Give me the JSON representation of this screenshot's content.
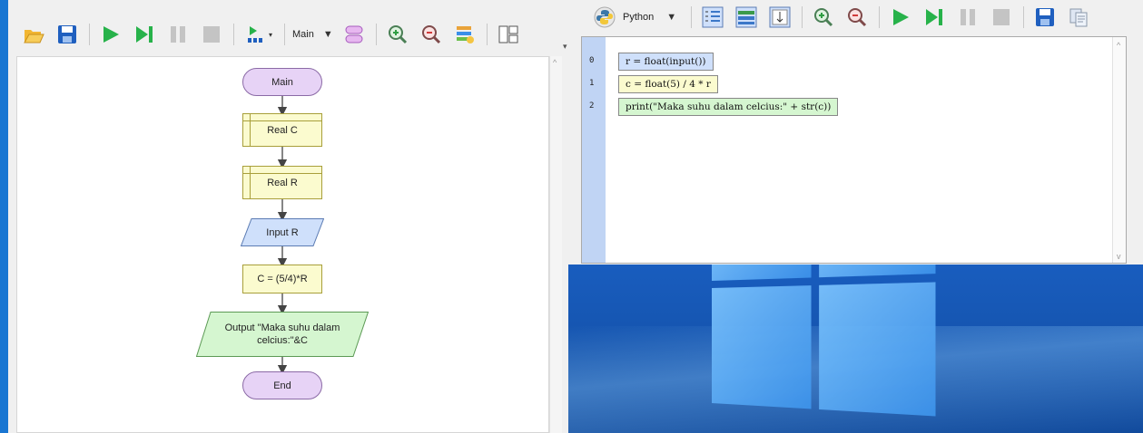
{
  "flowchart_window": {
    "toolbar": {
      "function_dropdown": "Main"
    },
    "shapes": {
      "start": "Main",
      "declare_c": "Real C",
      "declare_r": "Real R",
      "input": "Input R",
      "assign": "C = (5/4)*R",
      "output_line1": "Output \"Maka suhu dalam",
      "output_line2": "celcius:\"&C",
      "end": "End"
    }
  },
  "code_window": {
    "toolbar": {
      "language": "Python"
    },
    "lines": [
      {
        "number": "0",
        "code": "r = float(input())"
      },
      {
        "number": "1",
        "code": "c = float(5) / 4 * r"
      },
      {
        "number": "2",
        "code": "print(\"Maka suhu dalam celcius:\" + str(c))"
      }
    ]
  },
  "colors": {
    "terminal_fill": "#e7d3f6",
    "declare_fill": "#fbfbcf",
    "input_fill": "#cfe0fb",
    "output_fill": "#d5f6d0",
    "desktop_blue": "#1a60c4"
  }
}
